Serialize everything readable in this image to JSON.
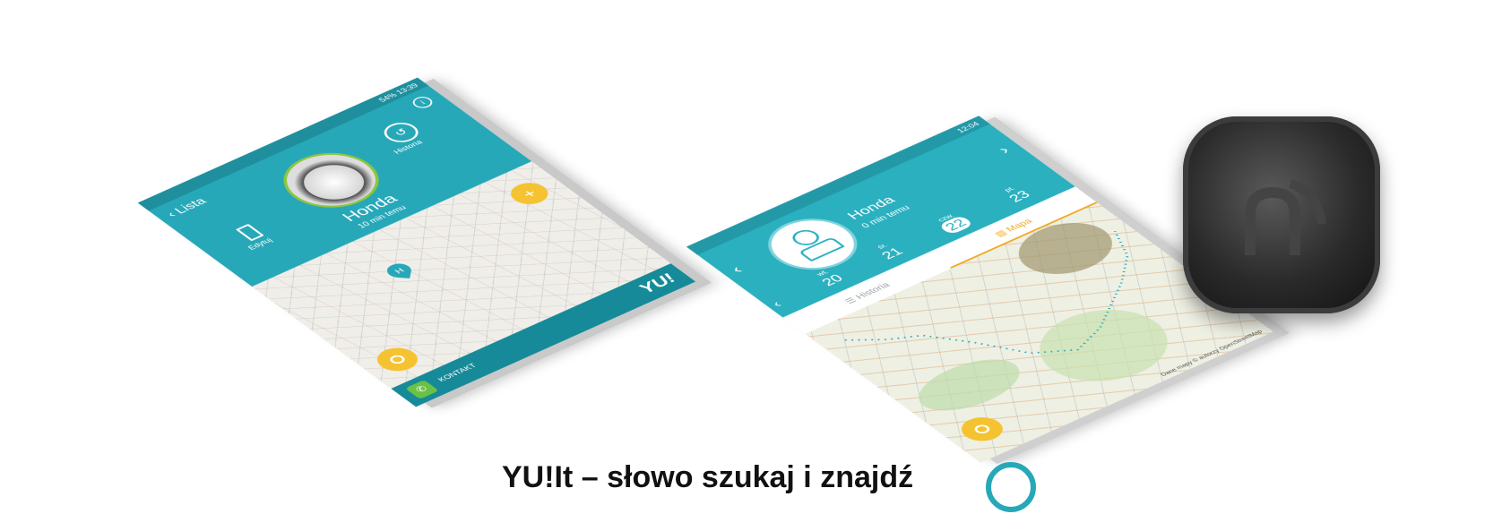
{
  "left_phone": {
    "status": "54% 13:39",
    "back_label": "Lista",
    "info_icon": "i",
    "history_label": "Historia",
    "edit_label": "Edytuj",
    "car_name": "Honda",
    "car_time": "10 min temu",
    "marker_letter": "H",
    "fab_plus": "+",
    "contact_label": "KONTAKT",
    "logo": "YU!"
  },
  "right_phone": {
    "status": "12:04",
    "car_name": "Honda",
    "car_time": "0 min temu",
    "days": [
      {
        "abbr": "wt.",
        "num": "20"
      },
      {
        "abbr": "śr.",
        "num": "21"
      },
      {
        "abbr": "czw.",
        "num": "22",
        "selected": true
      },
      {
        "abbr": "pt.",
        "num": "23"
      }
    ],
    "tabs": [
      "Historia",
      "Mapa"
    ],
    "active_tab": "Mapa",
    "attribution": "Dane mapy © autorzy OpenStreetMap"
  },
  "footer": {
    "title": "YU!It – słowo szukaj i znajdź",
    "icon": "circle-logo-icon"
  },
  "colors": {
    "primary": "#27a8b8",
    "accent": "#f5c331",
    "tab_active": "#f0a81e"
  }
}
